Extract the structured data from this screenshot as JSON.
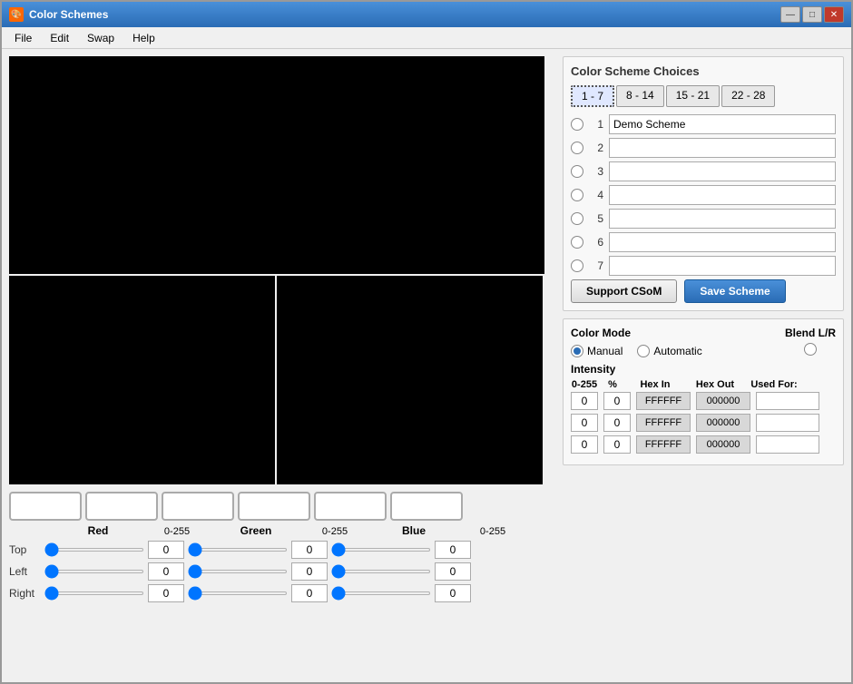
{
  "window": {
    "title": "Color Schemes",
    "icon": "🎨"
  },
  "menu": {
    "items": [
      "File",
      "Edit",
      "Swap",
      "Help"
    ]
  },
  "titleButtons": {
    "minimize": "—",
    "maximize": "□",
    "close": "✕"
  },
  "colorScheme": {
    "sectionTitle": "Color Scheme Choices",
    "tabs": [
      "1 - 7",
      "8 - 14",
      "15 - 21",
      "22 - 28"
    ],
    "activeTab": 0,
    "schemes": [
      {
        "num": "1",
        "value": "Demo Scheme"
      },
      {
        "num": "2",
        "value": ""
      },
      {
        "num": "3",
        "value": ""
      },
      {
        "num": "4",
        "value": ""
      },
      {
        "num": "5",
        "value": ""
      },
      {
        "num": "6",
        "value": ""
      },
      {
        "num": "7",
        "value": ""
      }
    ],
    "supportBtn": "Support CSoM",
    "saveBtn": "Save Scheme"
  },
  "colorMode": {
    "title": "Color Mode",
    "options": [
      "Manual",
      "Automatic"
    ],
    "selectedOption": "Manual",
    "blendLabel": "Blend L/R"
  },
  "intensity": {
    "title": "Intensity",
    "headers": [
      "0-255",
      "%",
      "Hex In",
      "Hex Out",
      "Used For:"
    ],
    "rows": [
      {
        "val255": "0",
        "pct": "0",
        "hexIn": "FFFFFF",
        "hexOut": "000000",
        "usedFor": ""
      },
      {
        "val255": "0",
        "pct": "0",
        "hexIn": "FFFFFF",
        "hexOut": "000000",
        "usedFor": ""
      },
      {
        "val255": "0",
        "pct": "0",
        "hexIn": "FFFFFF",
        "hexOut": "000000",
        "usedFor": ""
      }
    ]
  },
  "channelLabels": {
    "red": "Red",
    "green": "Green",
    "blue": "Blue",
    "range1": "0-255",
    "range2": "0-255",
    "range3": "0-255"
  },
  "rowLabels": [
    "Top",
    "Left",
    "Right"
  ],
  "sliderValues": {
    "top": {
      "r": "0",
      "g": "0",
      "b": "0"
    },
    "left": {
      "r": "0",
      "g": "0",
      "b": "0"
    },
    "right": {
      "r": "0",
      "g": "0",
      "b": "0"
    }
  }
}
